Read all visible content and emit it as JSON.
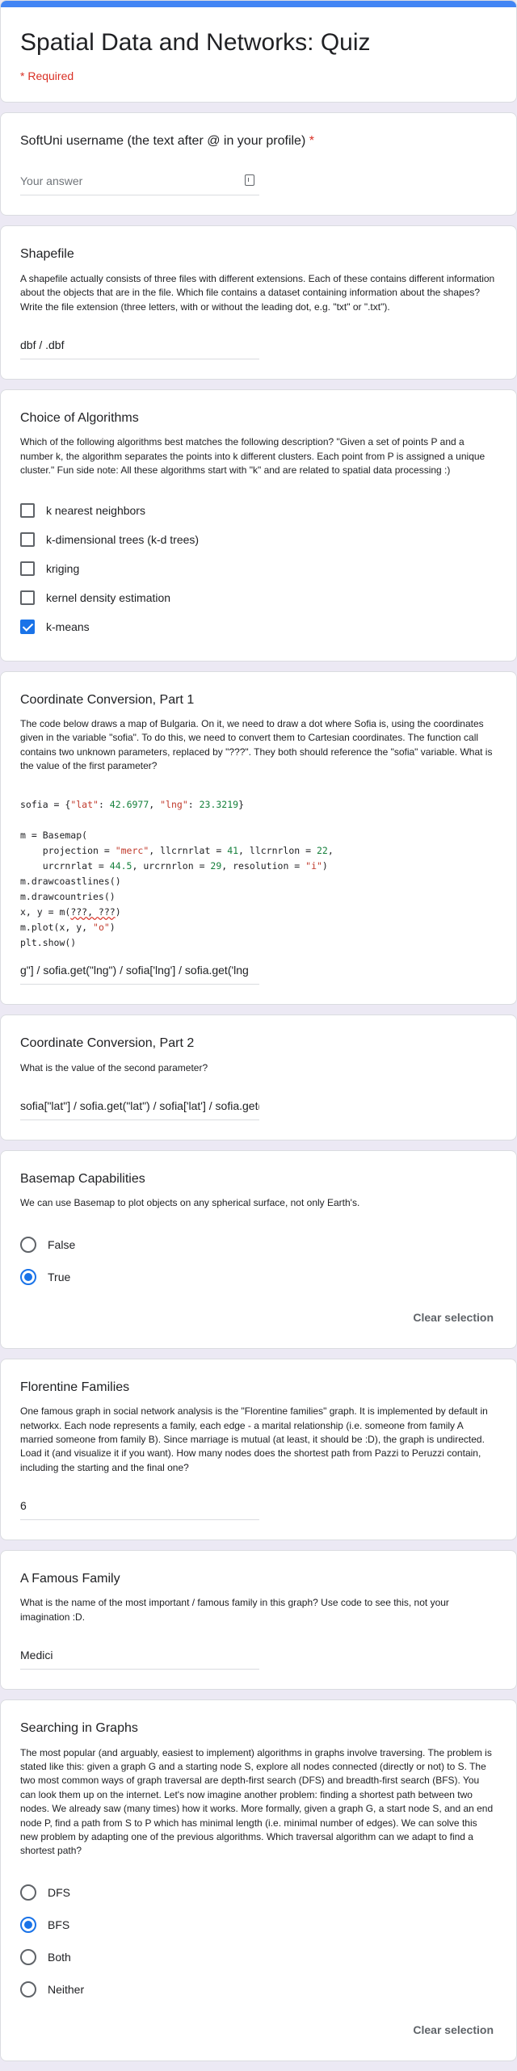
{
  "form": {
    "title": "Spatial Data and Networks: Quiz",
    "required_note": "* Required"
  },
  "q_username": {
    "title": "SoftUni username (the text after @ in your profile)",
    "required_mark": "*",
    "placeholder": "Your answer"
  },
  "q_shapefile": {
    "title": "Shapefile",
    "description": "A shapefile actually consists of three files with different extensions. Each of these contains different information about the objects that are in the file. Which file contains a dataset containing information about the shapes? Write the file extension (three letters, with or without the leading dot, e.g. \"txt\" or \".txt\").",
    "answer": "dbf / .dbf"
  },
  "q_algorithms": {
    "title": "Choice of Algorithms",
    "description": "Which of the following algorithms best matches the following description? \"Given a set of points P and a number k, the algorithm separates the points into k different clusters. Each point from P is assigned a unique cluster.\" Fun side note: All these algorithms start with \"k\" and are related to spatial data processing :)",
    "options": [
      {
        "label": "k nearest neighbors",
        "checked": false
      },
      {
        "label": "k-dimensional trees (k-d trees)",
        "checked": false
      },
      {
        "label": "kriging",
        "checked": false
      },
      {
        "label": "kernel density estimation",
        "checked": false
      },
      {
        "label": "k-means",
        "checked": true
      }
    ]
  },
  "q_coord1": {
    "title": "Coordinate Conversion, Part 1",
    "description": "The code below draws a map of Bulgaria. On it, we need to draw a dot where Sofia is, using the coordinates given in the variable \"sofia\". To do this, we need to convert them to Cartesian coordinates. The function call contains two unknown parameters, replaced by \"???\". They both should reference the \"sofia\" variable. What is the value of the first parameter?",
    "code": {
      "line1_a": "sofia = {",
      "line1_k1": "\"lat\"",
      "line1_b": ": ",
      "line1_v1": "42.6977",
      "line1_c": ", ",
      "line1_k2": "\"lng\"",
      "line1_d": ": ",
      "line1_v2": "23.3219",
      "line1_e": "}",
      "line2": "m = Basemap(",
      "line3_a": "    projection = ",
      "line3_s": "\"merc\"",
      "line3_b": ", llcrnrlat = ",
      "line3_n1": "41",
      "line3_c": ", llcrnrlon = ",
      "line3_n2": "22",
      "line3_d": ",",
      "line4_a": "    urcrnrlat = ",
      "line4_n1": "44.5",
      "line4_b": ", urcrnrlon = ",
      "line4_n2": "29",
      "line4_c": ", resolution = ",
      "line4_s": "\"i\"",
      "line4_d": ")",
      "line5": "m.drawcoastlines()",
      "line6": "m.drawcountries()",
      "line7_a": "x, y = m(",
      "line7_err": "???, ???",
      "line7_b": ")",
      "line8_a": "m.plot(x, y, ",
      "line8_s": "\"o\"",
      "line8_b": ")",
      "line9": "plt.show()"
    },
    "answer": "g\"] / sofia.get(\"lng\") / sofia['lng'] / sofia.get('lng"
  },
  "q_coord2": {
    "title": "Coordinate Conversion, Part 2",
    "description": "What is the value of the second parameter?",
    "answer": "sofia[\"lat\"] / sofia.get(\"lat\") / sofia['lat'] / sofia.get('lat')"
  },
  "q_basemap": {
    "title": "Basemap Capabilities",
    "description": "We can use Basemap to plot objects on any spherical surface, not only Earth's.",
    "options": [
      {
        "label": "False",
        "checked": false
      },
      {
        "label": "True",
        "checked": true
      }
    ],
    "clear_label": "Clear selection"
  },
  "q_florentine": {
    "title": "Florentine Families",
    "description": "One famous graph in social network analysis is the \"Florentine families\" graph. It is implemented by default in networkx. Each node represents a family, each edge - a marital relationship (i.e. someone from family A married someone from family B). Since marriage is mutual (at least, it should be :D), the graph is undirected. Load it (and visualize it if you want). How many nodes does the shortest path from Pazzi to Peruzzi contain, including the starting and the final one?",
    "answer": "6"
  },
  "q_famous": {
    "title": "A Famous Family",
    "description": "What is the name of the most important / famous family in this graph? Use code to see this, not your imagination :D.",
    "answer": "Medici"
  },
  "q_searching": {
    "title": "Searching in Graphs",
    "description": "The most popular (and arguably, easiest to implement) algorithms in graphs involve traversing. The problem is stated like this: given a graph G and a starting node S, explore all nodes connected (directly or not) to S. The two most common ways of graph traversal are depth-first search (DFS) and breadth-first search (BFS). You can look them up on the internet. Let's now imagine another problem: finding a shortest path between two nodes. We already saw (many times) how it works. More formally, given a graph G, a start node S, and an end node P, find a path from S to P which has minimal length (i.e. minimal number of edges). We can solve this new problem by adapting one of the previous algorithms. Which traversal algorithm can we adapt to find a shortest path?",
    "options": [
      {
        "label": "DFS",
        "checked": false
      },
      {
        "label": "BFS",
        "checked": true
      },
      {
        "label": "Both",
        "checked": false
      },
      {
        "label": "Neither",
        "checked": false
      }
    ],
    "clear_label": "Clear selection"
  }
}
